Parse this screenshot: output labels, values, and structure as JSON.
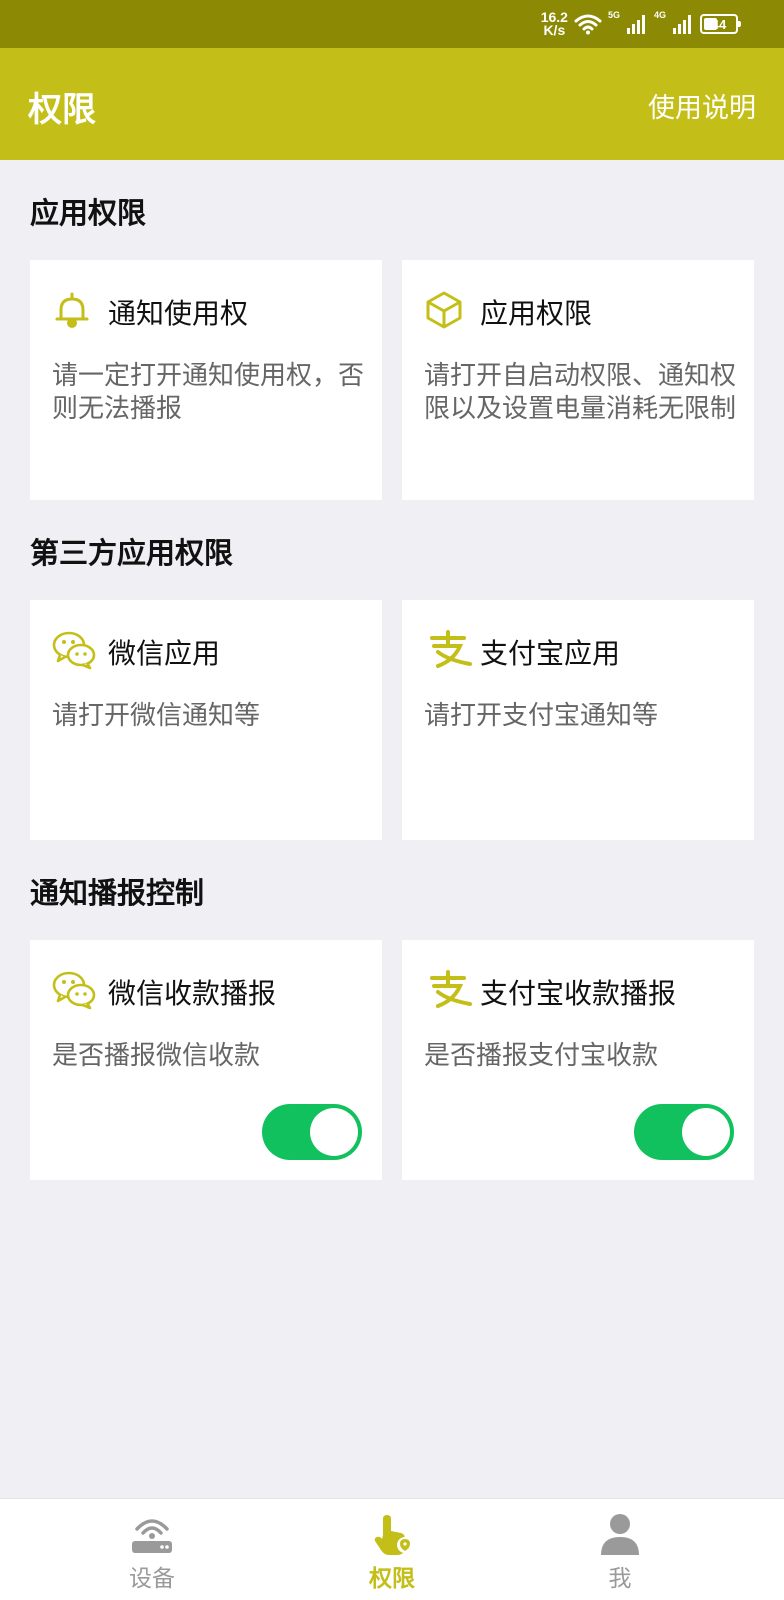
{
  "status_bar": {
    "net_speed_value": "16.2",
    "net_speed_unit": "K/s",
    "sig1_label": "5G",
    "sig2_label": "4G",
    "battery": "44",
    "battery_level_percent": 44
  },
  "app_bar": {
    "title": "权限",
    "help": "使用说明"
  },
  "colors": {
    "status_bar": "#8c8a04",
    "app_bar": "#c4bf18",
    "accent_icon": "#c4bf18",
    "toggle_on": "#10c15d",
    "background": "#efeff4"
  },
  "sections": [
    {
      "title": "应用权限",
      "cards": [
        {
          "icon": "bell-icon",
          "title": "通知使用权",
          "desc": "请一定打开通知使用权，否则无法播报"
        },
        {
          "icon": "cube-icon",
          "title": "应用权限",
          "desc": "请打开自启动权限、通知权限以及设置电量消耗无限制"
        }
      ]
    },
    {
      "title": "第三方应用权限",
      "cards": [
        {
          "icon": "wechat-icon",
          "title": "微信应用",
          "desc": "请打开微信通知等"
        },
        {
          "icon": "alipay-icon",
          "title": "支付宝应用",
          "desc": "请打开支付宝通知等"
        }
      ]
    },
    {
      "title": "通知播报控制",
      "cards": [
        {
          "icon": "wechat-icon",
          "title": "微信收款播报",
          "desc": "是否播报微信收款",
          "toggle": true
        },
        {
          "icon": "alipay-icon",
          "title": "支付宝收款播报",
          "desc": "是否播报支付宝收款",
          "toggle": true
        }
      ]
    }
  ],
  "bottom_nav": [
    {
      "icon": "router-icon",
      "label": "设备",
      "active": false
    },
    {
      "icon": "touch-lock-icon",
      "label": "权限",
      "active": true
    },
    {
      "icon": "person-icon",
      "label": "我",
      "active": false
    }
  ]
}
